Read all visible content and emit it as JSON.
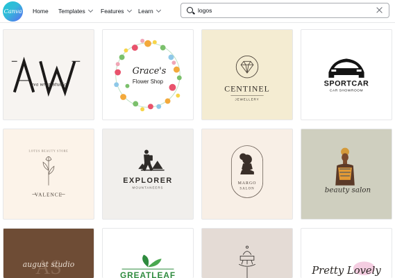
{
  "app": {
    "logo_text": "Canva",
    "nav": [
      {
        "label": "Home",
        "has_menu": false
      },
      {
        "label": "Templates",
        "has_menu": true
      },
      {
        "label": "Features",
        "has_menu": true
      },
      {
        "label": "Learn",
        "has_menu": true
      }
    ]
  },
  "search": {
    "value": "logos",
    "placeholder": "Search"
  },
  "templates": [
    {
      "name": "AW",
      "lines": [
        "AW",
        "ava wren studio"
      ]
    },
    {
      "name": "Grace's Flower Shop",
      "lines": [
        "Grace's",
        "Flower Shop"
      ]
    },
    {
      "name": "Centinel Jewellery",
      "lines": [
        "CENTINEL",
        "JEWELLERY"
      ]
    },
    {
      "name": "Sportcar Car Showroom",
      "lines": [
        "SPORTCAR",
        "CAR SHOWROOM"
      ]
    },
    {
      "name": "Valence",
      "lines": [
        "LOTUS BEAUTY STORE",
        "VALENCE"
      ]
    },
    {
      "name": "Explorer Mountaneers",
      "lines": [
        "EXPLORER",
        "MOUNTANEERS"
      ]
    },
    {
      "name": "Margo Salon",
      "lines": [
        "MARGO",
        "SALON"
      ]
    },
    {
      "name": "Beauty Salon",
      "lines": [
        "beauty salon"
      ]
    },
    {
      "name": "AS August Studio",
      "lines": [
        "AS",
        "august studio"
      ]
    },
    {
      "name": "Greatleaf",
      "lines": [
        "GREATLEAF"
      ]
    },
    {
      "name": "Cake Stand",
      "lines": []
    },
    {
      "name": "Pretty Lovely",
      "lines": [
        "Pretty Lovely"
      ]
    }
  ],
  "colors": {
    "accent": "#00c4cc",
    "card_backgrounds": [
      "#f7f4f1",
      "#ffffff",
      "#f4ecd2",
      "#ffffff",
      "#fcf3e9",
      "#f1efec",
      "#f8efe6",
      "#cfcfbf",
      "#6e4c35",
      "#ffffff",
      "#e4dbd5",
      "#ffffff"
    ]
  }
}
